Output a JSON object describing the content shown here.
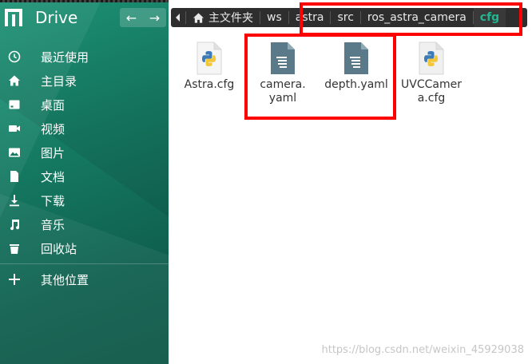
{
  "titlebar": {
    "app_title": "Drive",
    "back_glyph": "←",
    "forward_glyph": "→"
  },
  "sidebar": {
    "items": [
      {
        "label": "最近使用",
        "icon": "clock-icon"
      },
      {
        "label": "主目录",
        "icon": "home-icon"
      },
      {
        "label": "桌面",
        "icon": "desktop-icon"
      },
      {
        "label": "视频",
        "icon": "video-icon"
      },
      {
        "label": "图片",
        "icon": "picture-icon"
      },
      {
        "label": "文档",
        "icon": "document-icon"
      },
      {
        "label": "下载",
        "icon": "download-icon"
      },
      {
        "label": "音乐",
        "icon": "music-icon"
      },
      {
        "label": "回收站",
        "icon": "trash-icon"
      }
    ],
    "other": {
      "label": "其他位置",
      "icon": "plus-icon"
    }
  },
  "breadcrumb": {
    "crumbs": [
      "主文件夹",
      "ws",
      "astra",
      "src",
      "ros_astra_camera",
      "cfg"
    ],
    "active_index": 5
  },
  "files": [
    {
      "name_line1": "Astra.cfg",
      "name_line2": "",
      "type": "python"
    },
    {
      "name_line1": "camera.",
      "name_line2": "yaml",
      "type": "text"
    },
    {
      "name_line1": "depth.yaml",
      "name_line2": "",
      "type": "text"
    },
    {
      "name_line1": "UVCCamer",
      "name_line2": "a.cfg",
      "type": "python"
    }
  ],
  "watermark": "https://blog.csdn.net/weixin_45929038",
  "colors": {
    "accent": "#1fb791",
    "highlight": "#ff0000",
    "sidebar": "#157a62"
  }
}
